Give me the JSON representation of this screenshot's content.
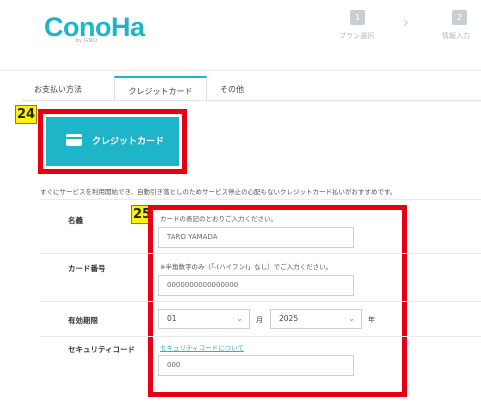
{
  "header": {
    "logo": "ConoHa",
    "logo_sub": "by GMO",
    "steps": [
      {
        "number": "1",
        "label": "プラン選択"
      },
      {
        "number": "2",
        "label": "情報入力"
      }
    ]
  },
  "tabs": [
    {
      "label": "お支払い方法"
    },
    {
      "label": "クレジットカード"
    },
    {
      "label": "その他"
    }
  ],
  "annotations": {
    "marker_24": "24",
    "marker_25": "25"
  },
  "payment_button": {
    "label": "クレジットカード"
  },
  "intro_text": "すぐにサービスを利用開始でき、自動引き落としのためサービス停止の心配もないクレジットカード払いがおすすめです。",
  "form": {
    "name": {
      "label": "名義",
      "hint": "カードの表記のとおりご入力ください。",
      "value": "TARO YAMADA"
    },
    "card_number": {
      "label": "カード番号",
      "hint": "※半角数字のみ（「-(ハイフン)」なし）でご入力ください。",
      "value": "0000000000000000"
    },
    "expiry": {
      "label": "有効期限",
      "month": "01",
      "month_unit": "月",
      "year": "2025",
      "year_unit": "年"
    },
    "security_code": {
      "label": "セキュリティコード",
      "link": "セキュリティコードについて",
      "value": "000"
    }
  },
  "colors": {
    "accent": "#1fb5c9",
    "highlight": "#e60012",
    "marker": "#fff200"
  }
}
